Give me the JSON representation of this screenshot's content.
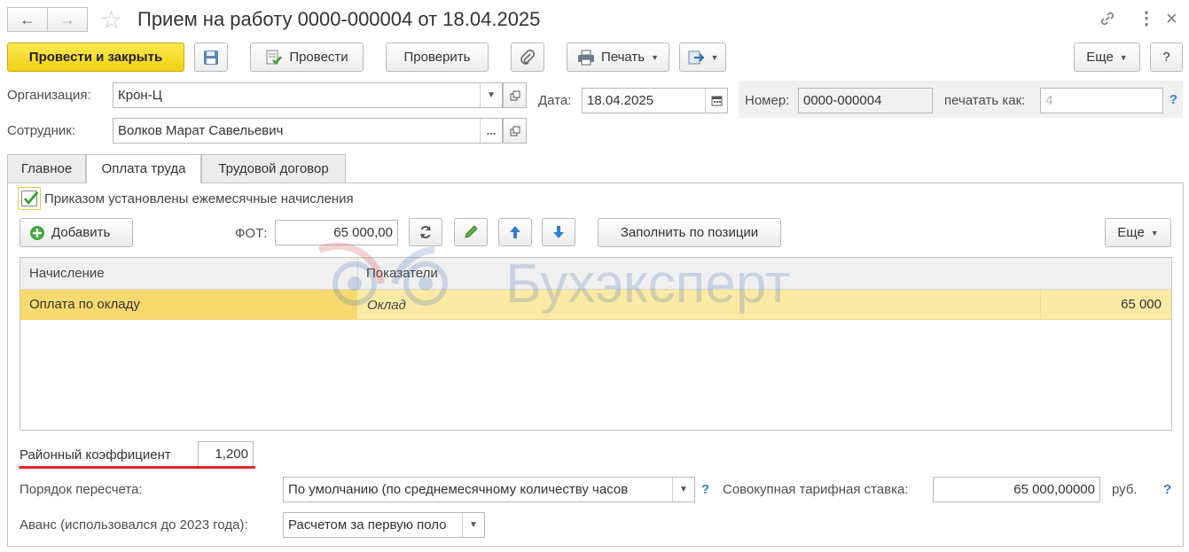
{
  "window": {
    "title": "Прием на работу 0000-000004 от 18.04.2025"
  },
  "toolbar": {
    "post_close": "Провести и закрыть",
    "post": "Провести",
    "check": "Проверить",
    "print": "Печать",
    "more": "Еще",
    "help": "?"
  },
  "header": {
    "org_label": "Организация:",
    "org_value": "Крон-Ц",
    "date_label": "Дата:",
    "date_value": "18.04.2025",
    "number_label": "Номер:",
    "number_value": "0000-000004",
    "print_as_label": "печатать как:",
    "print_as_value": "4",
    "help": "?",
    "employee_label": "Сотрудник:",
    "employee_value": "Волков Марат Савельевич"
  },
  "tabs": [
    "Главное",
    "Оплата труда",
    "Трудовой договор"
  ],
  "pay": {
    "checkbox_label": "Приказом установлены ежемесячные начисления",
    "add_label": "Добавить",
    "fot_label": "ФОТ:",
    "fot_value": "65 000,00",
    "fill_label": "Заполнить по позиции",
    "more_label": "Еще"
  },
  "grid": {
    "columns": [
      "Начисление",
      "Показатели"
    ],
    "rows": [
      {
        "accrual": "Оплата по окладу",
        "indicator": "Оклад",
        "value": "65 000"
      }
    ]
  },
  "footer": {
    "district_label": "Районный коэффициент",
    "district_value": "1,200",
    "recalc_label": "Порядок пересчета:",
    "recalc_value": "По умолчанию (по среднемесячному количеству часов",
    "total_rate_label": "Совокупная тарифная ставка:",
    "total_rate_value": "65 000,00000",
    "total_rate_unit": "руб.",
    "advance_label": "Аванс (использовался до 2023 года):",
    "advance_value": "Расчетом за первую поло",
    "help": "?"
  },
  "watermark": {
    "text": "Бухэксперт"
  },
  "colors": {
    "accent_yellow": "#f5dc2a",
    "selected_row": "#fbe9a5",
    "underline_red": "#e0262c",
    "help_blue": "#2f7fd0"
  }
}
